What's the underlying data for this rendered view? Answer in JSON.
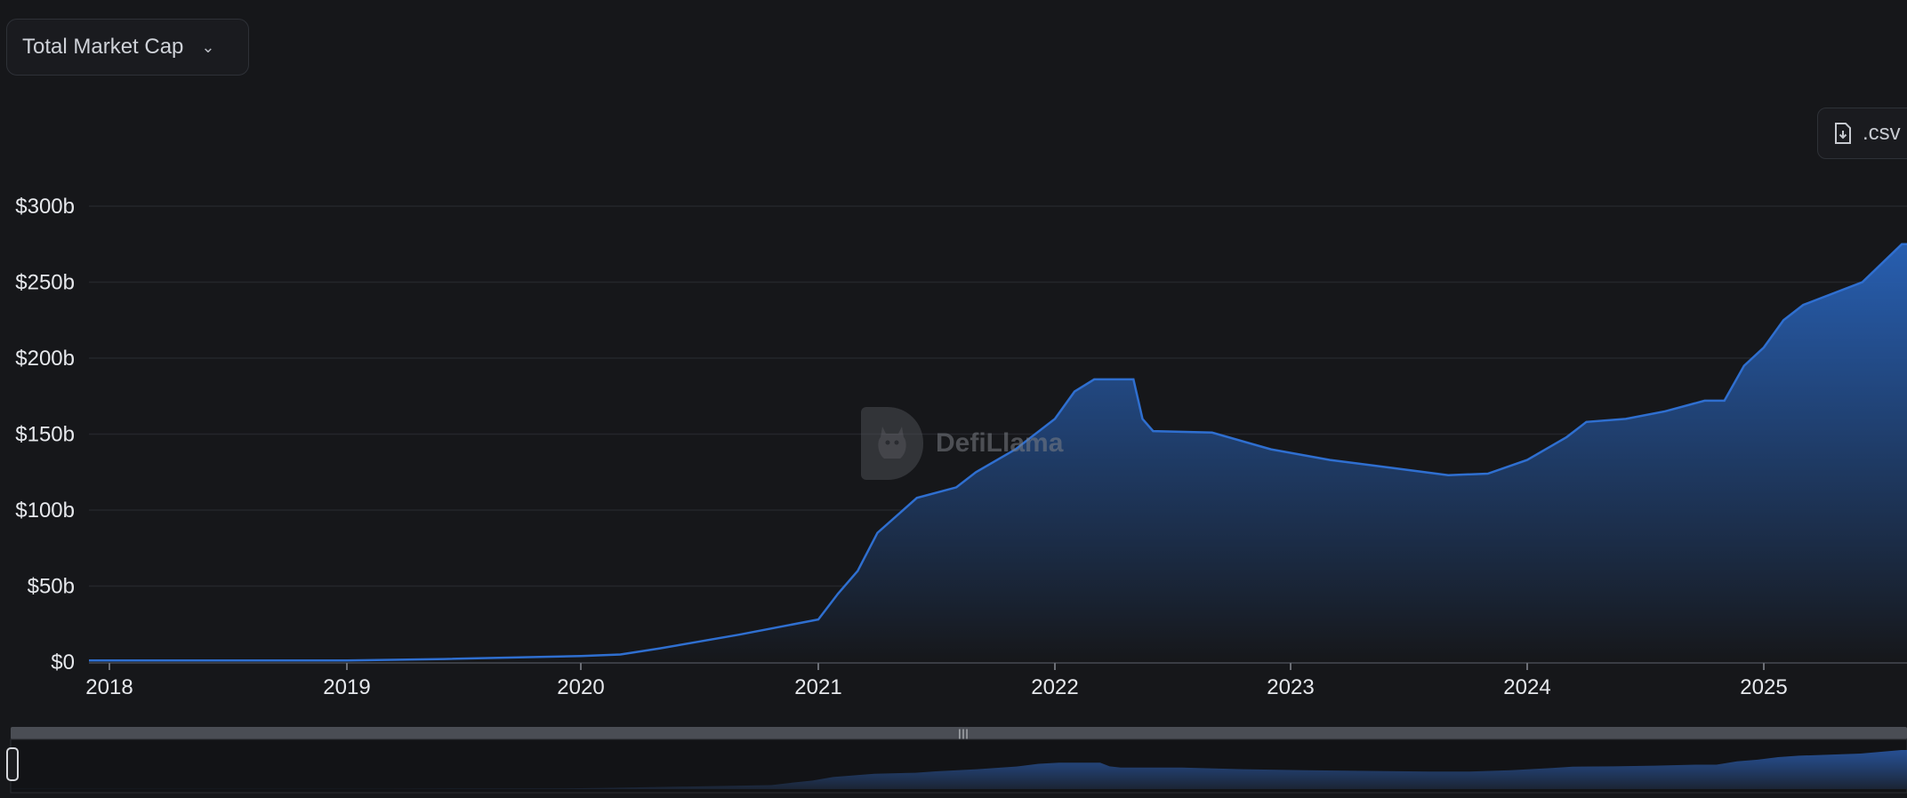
{
  "controls": {
    "metric_label": "Total Market Cap",
    "metric_chevron_icon": "chevron-down-icon",
    "csv_label": ".csv",
    "csv_icon": "file-download-icon"
  },
  "watermark": {
    "text": "DefiLlama"
  },
  "colors": {
    "background": "#16171a",
    "line": "#2f6fd0",
    "area_top": "#2862b8",
    "area_bottom": "#16171a",
    "grid": "#24262b",
    "axis_text": "#e6e8ec"
  },
  "chart_data": {
    "type": "area",
    "title": "",
    "xlabel": "",
    "ylabel": "",
    "ylim": [
      0,
      300
    ],
    "y_ticks": [
      "$0",
      "$50b",
      "$100b",
      "$150b",
      "$200b",
      "$250b",
      "$300b"
    ],
    "x_ticks": [
      "2018",
      "2019",
      "2020",
      "2021",
      "2022",
      "2023",
      "2024",
      "2025"
    ],
    "grid": true,
    "legend": "none",
    "series": [
      {
        "name": "",
        "unit": "$b",
        "x": [
          "2018-01",
          "2019-01",
          "2019-06",
          "2020-01",
          "2020-03",
          "2020-05",
          "2020-09",
          "2021-01",
          "2021-02",
          "2021-03",
          "2021-04",
          "2021-06",
          "2021-08",
          "2021-09",
          "2021-11",
          "2022-01",
          "2022-02",
          "2022-03",
          "2022-05",
          "2022-05-15",
          "2022-06",
          "2022-09",
          "2022-12",
          "2023-03",
          "2023-06",
          "2023-09",
          "2023-11",
          "2024-01",
          "2024-03",
          "2024-04",
          "2024-06",
          "2024-08",
          "2024-10",
          "2024-11",
          "2024-12",
          "2025-01",
          "2025-02",
          "2025-03",
          "2025-06",
          "2025-08"
        ],
        "values": [
          1,
          1,
          2,
          4,
          5,
          9,
          18,
          28,
          45,
          60,
          85,
          108,
          115,
          125,
          140,
          160,
          178,
          186,
          186,
          160,
          152,
          151,
          140,
          133,
          128,
          123,
          124,
          133,
          148,
          158,
          160,
          165,
          172,
          172,
          195,
          207,
          225,
          235,
          250,
          275
        ]
      }
    ]
  }
}
